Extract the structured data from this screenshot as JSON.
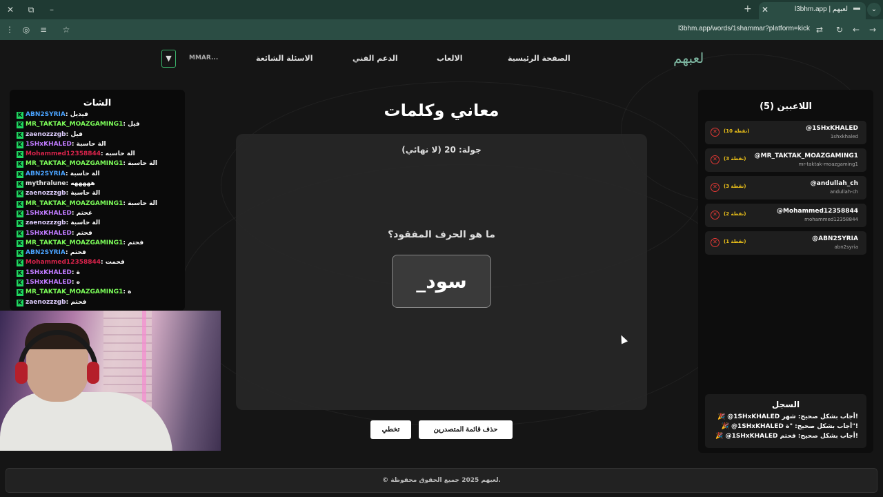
{
  "browser": {
    "tab_title": "l3bhm.app | لعبهم",
    "url": "l3bhm.app/words/1shammar?platform=kick",
    "new_tab": "+",
    "tab_close": "✕",
    "window_close": "✕",
    "window_restore": "⧉",
    "window_min": "–"
  },
  "nav": {
    "logo": "لعبهم",
    "links": [
      "الصفحة الرئيسية",
      "الالعاب",
      "الدعم الفني",
      "الاسئلة الشائعة"
    ],
    "user_name": "MMAR...",
    "user_badge": "▼"
  },
  "chat": {
    "title": "الشات",
    "messages": [
      {
        "user": "ABN2SYRIA",
        "text": "فيديل",
        "color": "#4aa3ff"
      },
      {
        "user": "MR_TAKTAK_MOAZGAMING1",
        "text": "فيل",
        "color": "#7dff5a"
      },
      {
        "user": "zaenozzzgb",
        "text": "فيل",
        "color": "#e0d0ff"
      },
      {
        "user": "1SHxKHALED",
        "text": "الة حاسبة",
        "color": "#c07bff"
      },
      {
        "user": "Mohammed12358844",
        "text": "آلة حاسبه",
        "color": "#d9234b"
      },
      {
        "user": "MR_TAKTAK_MOAZGAMING1",
        "text": "آلة حاسبة",
        "color": "#7dff5a"
      },
      {
        "user": "ABN2SYRIA",
        "text": "آلة حاسبة",
        "color": "#4aa3ff"
      },
      {
        "user": "mythralune",
        "text": "هههههه",
        "color": "#e6e6e6"
      },
      {
        "user": "zaenozzzgb",
        "text": "الة حاسبة",
        "color": "#e0d0ff"
      },
      {
        "user": "MR_TAKTAK_MOAZGAMING1",
        "text": "آلة حاسبة",
        "color": "#7dff5a"
      },
      {
        "user": "1SHxKHALED",
        "text": "غحتم",
        "color": "#c07bff"
      },
      {
        "user": "zaenozzzgb",
        "text": "آلة حاسبة",
        "color": "#e0d0ff"
      },
      {
        "user": "1SHxKHALED",
        "text": "فحتم",
        "color": "#c07bff"
      },
      {
        "user": "MR_TAKTAK_MOAZGAMING1",
        "text": "فحتم",
        "color": "#7dff5a"
      },
      {
        "user": "ABN2SYRIA",
        "text": "فحتم",
        "color": "#4aa3ff"
      },
      {
        "user": "Mohammed12358844",
        "text": "فحمت",
        "color": "#d9234b"
      },
      {
        "user": "1SHxKHALED",
        "text": "ة",
        "color": "#c07bff"
      },
      {
        "user": "1SHxKHALED",
        "text": "ه",
        "color": "#c07bff"
      },
      {
        "user": "MR_TAKTAK_MOAZGAMING1",
        "text": "ة",
        "color": "#7dff5a"
      },
      {
        "user": "zaenozzzgb",
        "text": "فحتم",
        "color": "#e0d0ff"
      }
    ]
  },
  "game": {
    "title": "معاني وكلمات",
    "round": "جولة: 20 (لا نهائي)",
    "question": "ما هو الحرف المفقود؟",
    "word": "_سود",
    "clear_leaderboard": "حذف قائمة المتصدرين",
    "skip": "تخطي"
  },
  "players": {
    "title": "اللاعبين (5)",
    "list": [
      {
        "name": "@1SHxKHALED",
        "username": "1shxkhaled",
        "score": "(10 نقطة)"
      },
      {
        "name": "@MR_TAKTAK_MOAZGAMING1",
        "username": "mr-taktak-moazgaming1",
        "score": "(3 نقطة)"
      },
      {
        "name": "@andullah_ch",
        "username": "andullah-ch",
        "score": "(3 نقطة)"
      },
      {
        "name": "@Mohammed12358844",
        "username": "mohammed12358844",
        "score": "(2 نقطة)"
      },
      {
        "name": "@ABN2SYRIA",
        "username": "abn2syria",
        "score": "(1 نقطة)"
      }
    ],
    "remove_glyph": "✕"
  },
  "log": {
    "title": "السجل",
    "entries": [
      "🎉 @1SHxKHALED أجاب بشكل صحيح: شهر!",
      "🎉 @1SHxKHALED أجاب بشكل صحيح: \"ة\"!",
      "🎉 @1SHxKHALED أجاب بشكل صحيح: فحتم!"
    ]
  },
  "footer": {
    "text": "© لعبهم 2025 جميع الحقوق محفوظة."
  },
  "colors": {
    "accent": "#3bb36b",
    "score": "#f0c419",
    "remove": "#e53935"
  }
}
